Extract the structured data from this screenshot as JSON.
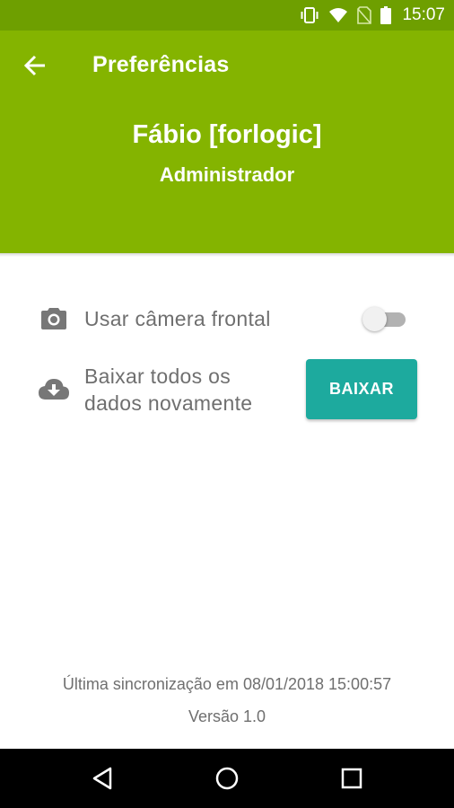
{
  "status_bar": {
    "time": "15:07",
    "icons": [
      "vibrate-icon",
      "wifi-icon",
      "no-sim-icon",
      "battery-icon"
    ]
  },
  "toolbar": {
    "back_icon": "arrow-back-icon",
    "title": "Preferências"
  },
  "profile": {
    "name": "Fábio [forlogic]",
    "role": "Administrador"
  },
  "settings": {
    "front_camera": {
      "icon": "camera-icon",
      "label": "Usar câmera frontal",
      "enabled": false
    },
    "download_all": {
      "icon": "cloud-download-icon",
      "label_line1": "Baixar todos os",
      "label_line2": "dados novamente",
      "button_label": "BAIXAR"
    }
  },
  "footer": {
    "last_sync": "Última sincronização em 08/01/2018 15:00:57",
    "version": "Versão 1.0"
  },
  "nav_bar": {
    "buttons": [
      "back-triangle-icon",
      "home-circle-icon",
      "recents-square-icon"
    ]
  },
  "colors": {
    "status_bar": "#6e9f00",
    "header": "#84b400",
    "button": "#1daa9e",
    "text_secondary": "#6f6f6f"
  }
}
